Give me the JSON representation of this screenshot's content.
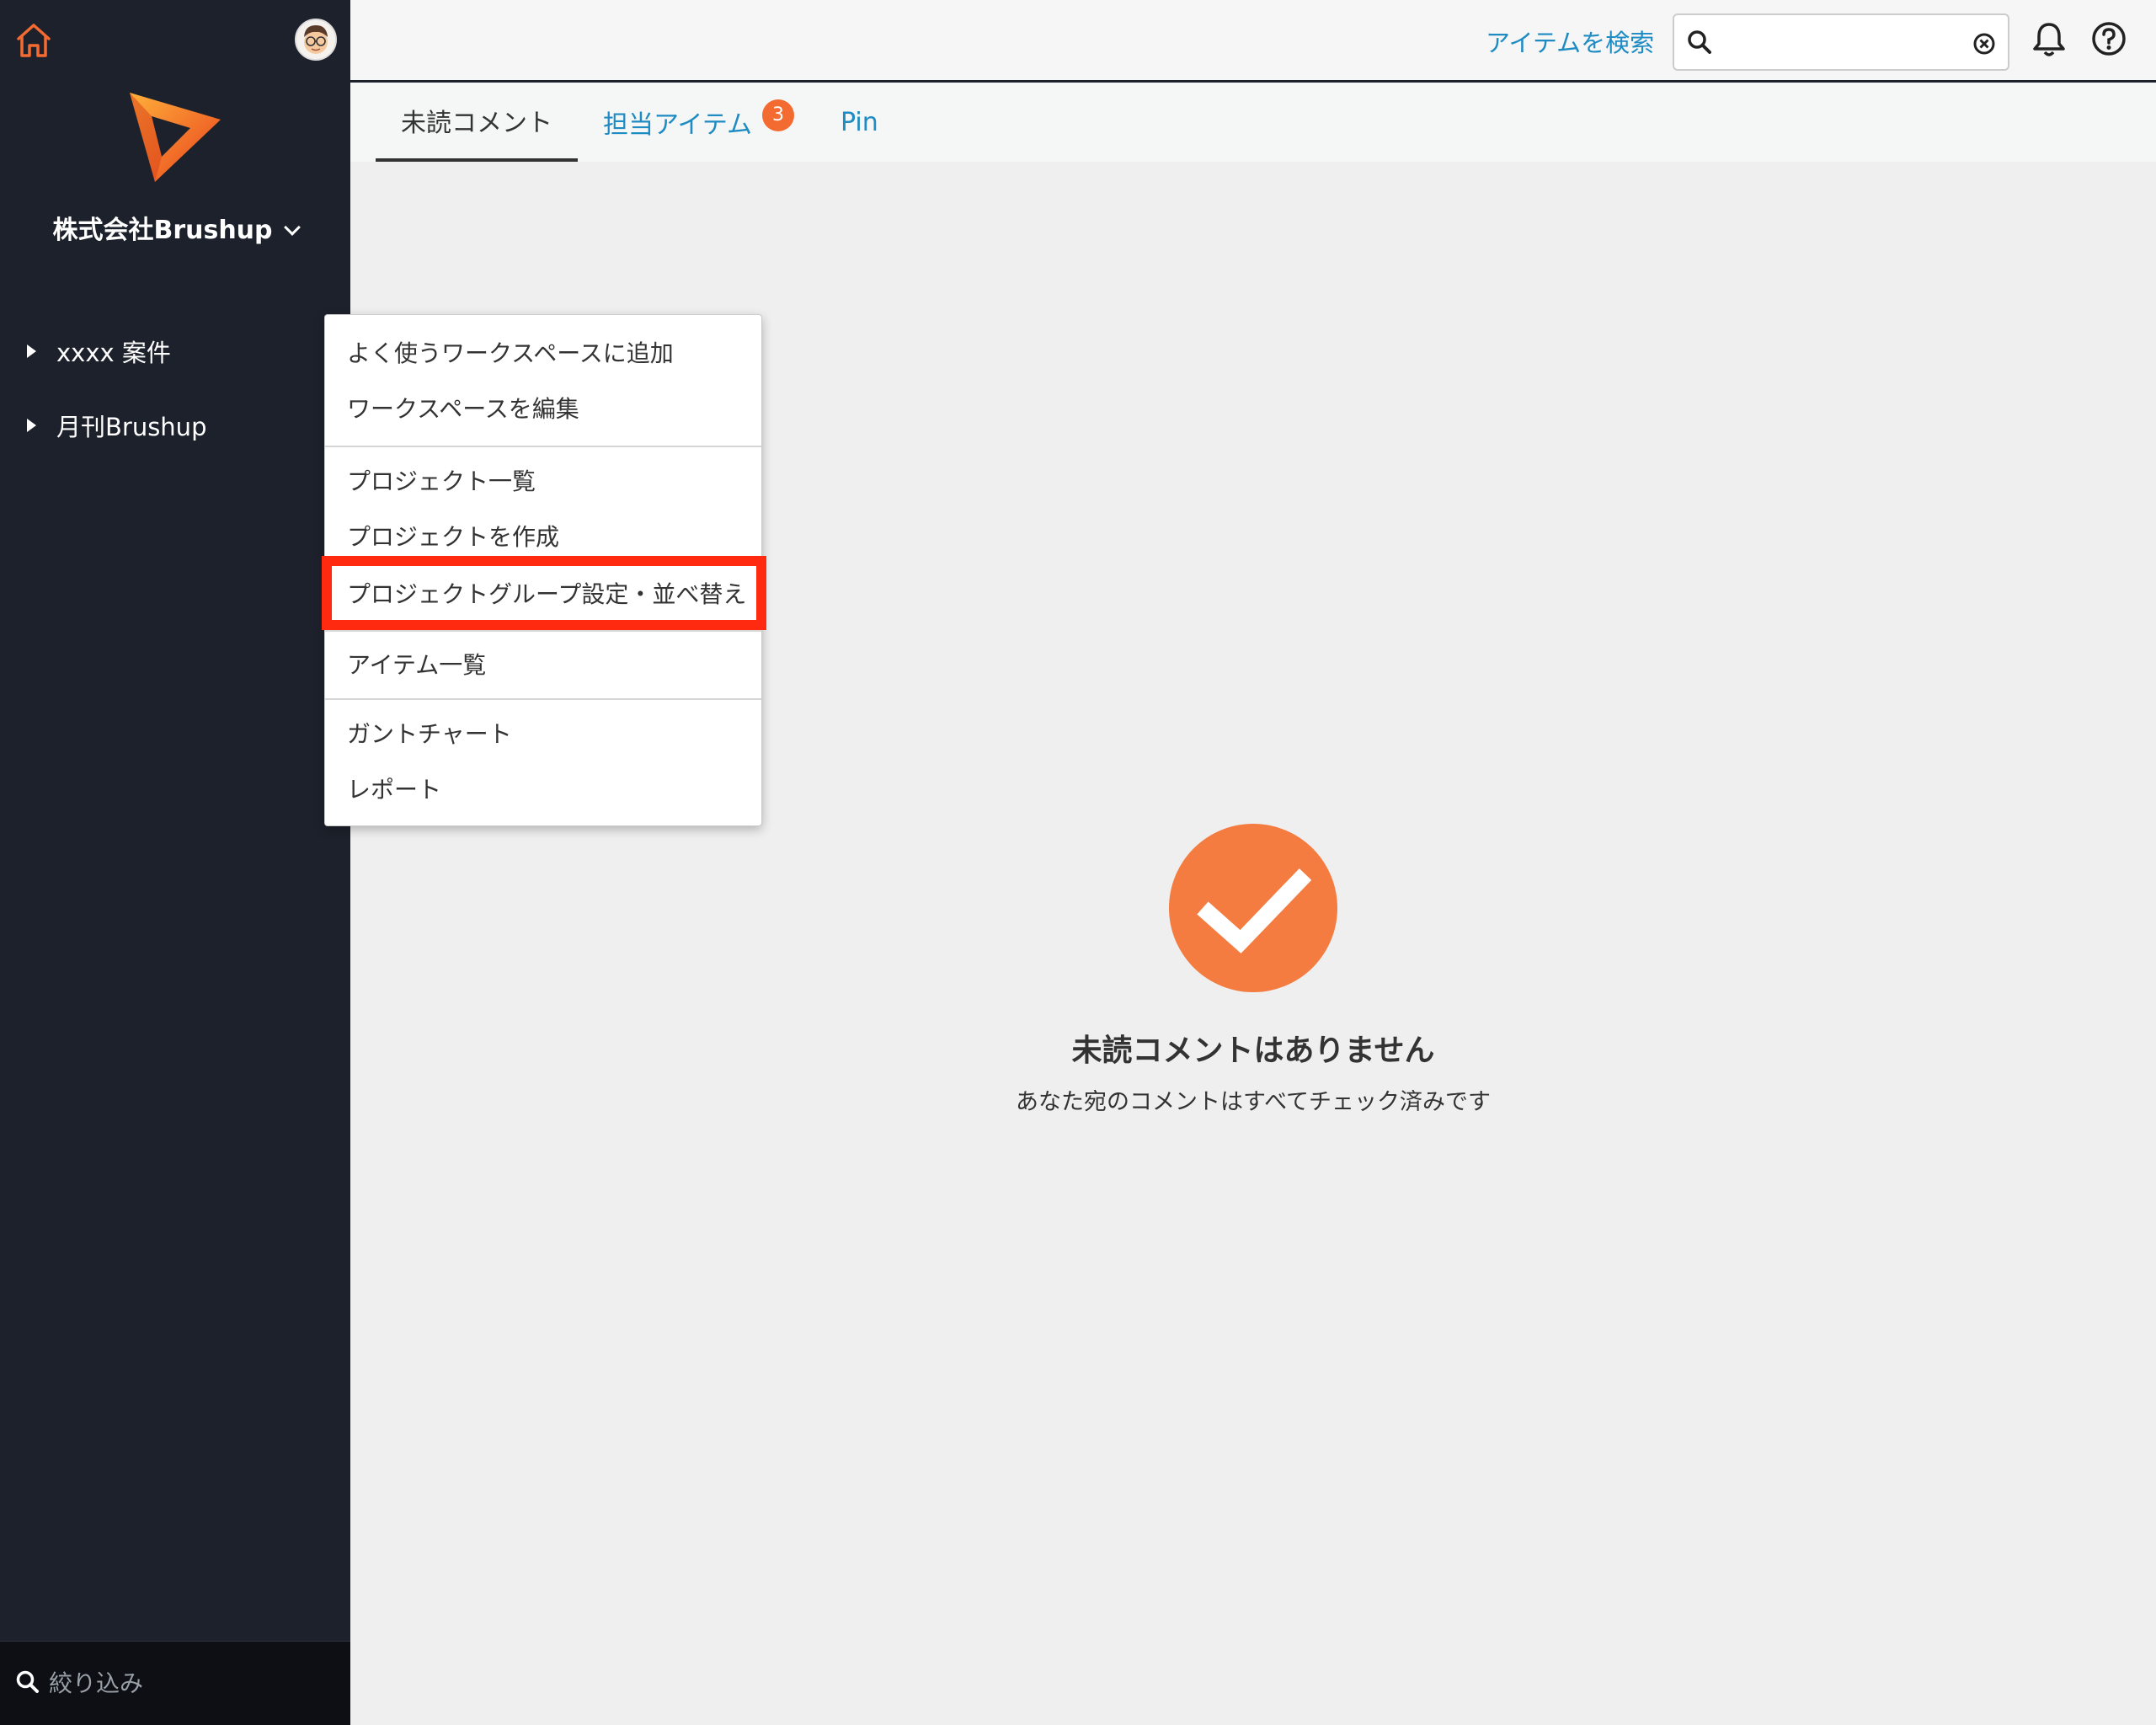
{
  "sidebar": {
    "company_name": "株式会社Brushup",
    "workspaces": [
      {
        "label": "xxxx 案件"
      },
      {
        "label": "月刊Brushup"
      }
    ],
    "filter_placeholder": "絞り込み",
    "icons": [
      "home-icon",
      "avatar",
      "logo",
      "search-icon"
    ]
  },
  "header": {
    "search_link": "アイテムを検索",
    "search_value": "",
    "icons": [
      "search-icon",
      "clear-icon",
      "bell-icon",
      "help-icon"
    ]
  },
  "tabs": [
    {
      "label": "未読コメント",
      "active": true
    },
    {
      "label": "担当アイテム",
      "badge": "3"
    },
    {
      "label": "Pin"
    }
  ],
  "empty_state": {
    "title": "未読コメントはありません",
    "subtitle": "あなた宛のコメントはすべてチェック済みです"
  },
  "context_menu": {
    "items": [
      "よく使うワークスペースに追加",
      "ワークスペースを編集",
      "プロジェクト一覧",
      "プロジェクトを作成",
      "プロジェクトグループ設定・並べ替え",
      "アイテム一覧",
      "ガントチャート",
      "レポート"
    ],
    "highlighted_index": 4
  },
  "colors": {
    "sidebar_bg": "#1d212b",
    "accent_orange": "#f47c41",
    "link_blue": "#1e8bc3",
    "highlight_red": "#ff2a10"
  }
}
